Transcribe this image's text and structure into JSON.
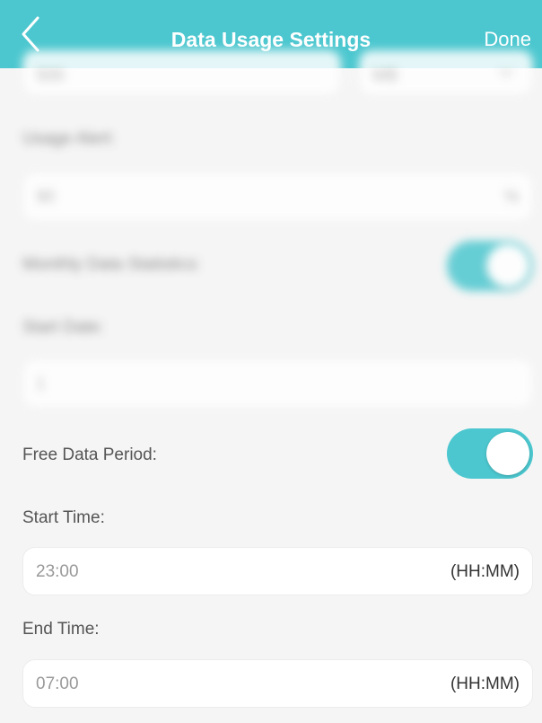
{
  "header": {
    "title": "Data Usage Settings",
    "done_label": "Done"
  },
  "blurred": {
    "top_field_value": "500",
    "top_unit_value": "MB",
    "usage_alert_label": "Usage Alert:",
    "usage_alert_value": "90",
    "usage_alert_unit": "%",
    "monthly_stats_label": "Monthly Data Statistics:",
    "start_date_label": "Start Date:",
    "start_date_value": "1"
  },
  "free_data": {
    "label": "Free Data Period:",
    "enabled": true,
    "start_time_label": "Start Time:",
    "start_time_value": "23:00",
    "start_time_unit": "(HH:MM)",
    "end_time_label": "End Time:",
    "end_time_value": "07:00",
    "end_time_unit": "(HH:MM)"
  },
  "colors": {
    "accent": "#4cc7cf",
    "background": "#f5f5f5"
  },
  "icons": {
    "back": "chevron-left-icon",
    "dropdown": "chevron-down-icon"
  }
}
